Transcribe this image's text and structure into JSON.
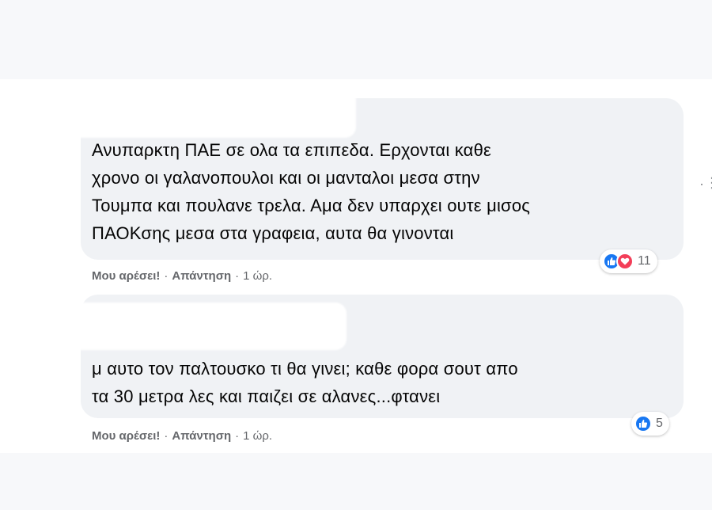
{
  "comments": [
    {
      "text": "Ανυπαρκτη ΠΑΕ σε ολα τα επιπεδα. Ερχονται καθε\nχρονο οι γαλανοπουλοι και οι μανταλοι μεσα στην\nΤουμπα και πουλανε τρελα. Αμα δεν υπαρχει ουτε μισος\nΠΑΟΚσης μεσα στα γραφεια, αυτα θα γινονται",
      "like_label": "Μου αρέσει!",
      "reply_label": "Απάντηση",
      "time": "1 ώρ.",
      "reaction_count": "11",
      "reactions": [
        "like-icon",
        "love-icon"
      ]
    },
    {
      "text": "μ αυτο τον παλτουσκο τι θα γινει; καθε φορα σουτ απο\nτα 30 μετρα λες και παιζει σε αλανες...φτανει",
      "like_label": "Μου αρέσει!",
      "reply_label": "Απάντηση",
      "time": "1 ώρ.",
      "reaction_count": "5",
      "reactions": [
        "like-icon"
      ]
    }
  ],
  "separator": "·",
  "more_icon": "more-options-icon",
  "colors": {
    "bubble": "#f0f2f5",
    "like_blue": "#1877f2",
    "love_red": "#f33e58",
    "meta_gray": "#65676b"
  }
}
